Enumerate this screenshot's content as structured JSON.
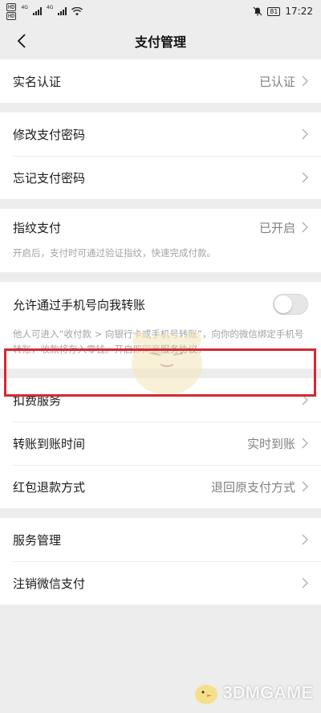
{
  "statusbar": {
    "left_badges": [
      "HD",
      "HD"
    ],
    "signal_labels": [
      "4G",
      "4G"
    ],
    "battery": "81",
    "time": "17:22"
  },
  "header": {
    "title": "支付管理",
    "back_icon": "chevron-left-icon"
  },
  "sections": {
    "realname": {
      "label": "实名认证",
      "value": "已认证"
    },
    "password": [
      {
        "label": "修改支付密码"
      },
      {
        "label": "忘记支付密码"
      }
    ],
    "fingerprint": {
      "label": "指纹支付",
      "value": "已开启",
      "desc": "开启后，支付时可通过验证指纹，快速完成付款。"
    },
    "phone_transfer": {
      "label": "允许通过手机号向我转账",
      "toggle_on": false,
      "desc_part1": "他人可进入“收付款 > 向银行卡或手机号转账”，向你的微信绑定手机号转账，收款将存入零钱。开启即同意",
      "desc_link": "服务协议",
      "desc_end": "。"
    },
    "services": [
      {
        "label": "扣费服务",
        "value": ""
      },
      {
        "label": "转账到账时间",
        "value": "实时到账"
      },
      {
        "label": "红包退款方式",
        "value": "退回原支付方式"
      }
    ],
    "manage": [
      {
        "label": "服务管理"
      },
      {
        "label": "注销微信支付"
      }
    ]
  },
  "annotation": {
    "highlight_color": "#d62831"
  },
  "watermark": {
    "text": "3DMGAME"
  },
  "colors": {
    "background": "#ededed",
    "link": "#576b95",
    "secondary_text": "#808080"
  }
}
